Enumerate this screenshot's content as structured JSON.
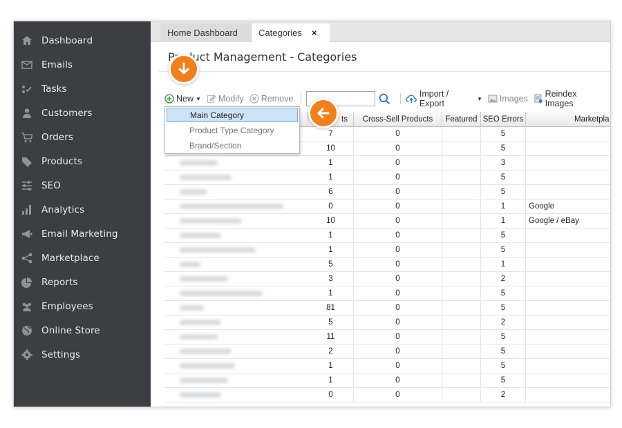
{
  "sidebar": {
    "items": [
      {
        "label": "Dashboard",
        "icon": "home-icon"
      },
      {
        "label": "Emails",
        "icon": "envelope-icon"
      },
      {
        "label": "Tasks",
        "icon": "tasks-icon"
      },
      {
        "label": "Customers",
        "icon": "person-icon"
      },
      {
        "label": "Orders",
        "icon": "cart-icon"
      },
      {
        "label": "Products",
        "icon": "tag-icon"
      },
      {
        "label": "SEO",
        "icon": "sliders-icon"
      },
      {
        "label": "Analytics",
        "icon": "bar-chart-icon"
      },
      {
        "label": "Email Marketing",
        "icon": "megaphone-icon"
      },
      {
        "label": "Marketplace",
        "icon": "share-icon"
      },
      {
        "label": "Reports",
        "icon": "pie-chart-icon"
      },
      {
        "label": "Employees",
        "icon": "group-icon"
      },
      {
        "label": "Online Store",
        "icon": "globe-icon"
      },
      {
        "label": "Settings",
        "icon": "gear-icon"
      }
    ]
  },
  "tabs": {
    "home": "Home Dashboard",
    "categories": "Categories",
    "close": "×"
  },
  "page": {
    "title": "Product Management - Categories"
  },
  "toolbar": {
    "new": "New",
    "modify": "Modify",
    "remove": "Remove",
    "search_value": "",
    "import_export": "Import / Export",
    "images": "Images",
    "reindex": "Reindex Images"
  },
  "new_menu": {
    "items": [
      "Main Category",
      "Product Type Category",
      "Brand/Section"
    ],
    "selected": "Main Category"
  },
  "grid": {
    "columns": {
      "products": "ts",
      "cross_sell": "Cross-Sell Products",
      "featured": "Featured",
      "seo_errors": "SEO Errors",
      "marketplace": "Marketpla"
    },
    "rows": [
      {
        "products": "7",
        "cross_sell": "0",
        "seo": "5",
        "market": ""
      },
      {
        "products": "10",
        "cross_sell": "0",
        "seo": "5",
        "market": ""
      },
      {
        "products": "1",
        "cross_sell": "0",
        "seo": "3",
        "market": ""
      },
      {
        "products": "1",
        "cross_sell": "0",
        "seo": "5",
        "market": ""
      },
      {
        "products": "6",
        "cross_sell": "0",
        "seo": "5",
        "market": ""
      },
      {
        "products": "0",
        "cross_sell": "0",
        "seo": "1",
        "market": "Google"
      },
      {
        "products": "10",
        "cross_sell": "0",
        "seo": "1",
        "market": "Google / eBay"
      },
      {
        "products": "1",
        "cross_sell": "0",
        "seo": "5",
        "market": ""
      },
      {
        "products": "1",
        "cross_sell": "0",
        "seo": "5",
        "market": ""
      },
      {
        "products": "5",
        "cross_sell": "0",
        "seo": "1",
        "market": ""
      },
      {
        "products": "3",
        "cross_sell": "0",
        "seo": "2",
        "market": ""
      },
      {
        "products": "1",
        "cross_sell": "0",
        "seo": "5",
        "market": ""
      },
      {
        "products": "81",
        "cross_sell": "0",
        "seo": "5",
        "market": ""
      },
      {
        "products": "5",
        "cross_sell": "0",
        "seo": "2",
        "market": ""
      },
      {
        "products": "11",
        "cross_sell": "0",
        "seo": "5",
        "market": ""
      },
      {
        "products": "2",
        "cross_sell": "0",
        "seo": "5",
        "market": ""
      },
      {
        "products": "1",
        "cross_sell": "0",
        "seo": "5",
        "market": ""
      },
      {
        "products": "1",
        "cross_sell": "0",
        "seo": "5",
        "market": ""
      },
      {
        "products": "0",
        "cross_sell": "0",
        "seo": "2",
        "market": ""
      }
    ]
  },
  "colors": {
    "sidebar_bg": "#3b3e43",
    "accent_orange": "#f0801e",
    "selection_blue": "#cfe3f8"
  }
}
